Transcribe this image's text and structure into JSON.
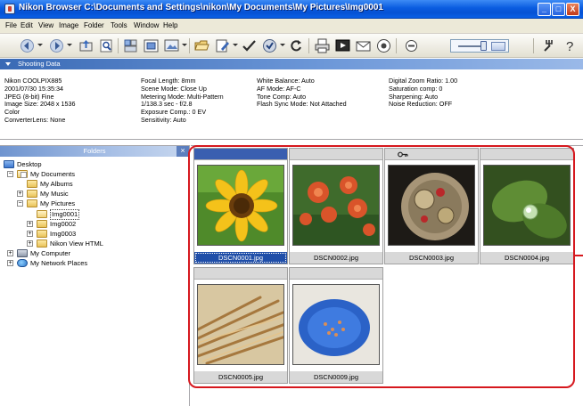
{
  "window": {
    "title": "Nikon Browser C:\\Documents and Settings\\nikon\\My Documents\\My Pictures\\Img0001",
    "buttons": {
      "minimize": "_",
      "maximize": "□",
      "close": "X"
    }
  },
  "menubar": [
    {
      "id": "file",
      "label": "File"
    },
    {
      "id": "edit",
      "label": "Edit"
    },
    {
      "id": "view",
      "label": "View"
    },
    {
      "id": "image",
      "label": "Image"
    },
    {
      "id": "folder",
      "label": "Folder"
    },
    {
      "id": "tools",
      "label": "Tools"
    },
    {
      "id": "window",
      "label": "Window"
    },
    {
      "id": "help",
      "label": "Help"
    }
  ],
  "toolbar": {
    "icons": [
      "back-icon",
      "forward-icon",
      "up-folder-icon",
      "search-icon",
      "browse-icon",
      "view-mode-icon",
      "slideshow-icon",
      "open-folder-icon",
      "edit-icon",
      "check-icon",
      "transfer-icon",
      "rotate-icon",
      "print-icon",
      "presentation-icon",
      "email-icon",
      "info-icon",
      "thumbnail-size-slider",
      "grid-icon",
      "settings-icon",
      "help-icon"
    ]
  },
  "shooting_data": {
    "header": "Shooting Data",
    "columns": [
      [
        "Nikon COOLPIX885",
        "2001/07/30 15:35:34",
        "JPEG (8-bit) Fine",
        "Image Size: 2048 x 1536",
        "Color",
        "ConverterLens: None"
      ],
      [
        "Focal Length: 8mm",
        "Scene Mode: Close Up",
        "Metering Mode: Multi-Pattern",
        "1/138.3 sec - f/2.8",
        "Exposure Comp.: 0 EV",
        "Sensitivity: Auto"
      ],
      [
        "White Balance: Auto",
        "AF Mode: AF-C",
        "Tone Comp: Auto",
        "Flash Sync Mode: Not Attached"
      ],
      [
        "Digital Zoom Ratio: 1.00",
        "Saturation comp: 0",
        "Sharpening: Auto",
        "Noise Reduction: OFF"
      ]
    ]
  },
  "folders": {
    "header": "Folders",
    "close": "×",
    "tree": [
      {
        "label": "Desktop",
        "icon": "desktop-icon",
        "toggle": ""
      },
      {
        "label": "My Documents",
        "icon": "documents-icon",
        "toggle": "−"
      },
      {
        "label": "My Albums",
        "icon": "folder-icon",
        "toggle": ""
      },
      {
        "label": "My Music",
        "icon": "folder-icon",
        "toggle": "+"
      },
      {
        "label": "My Pictures",
        "icon": "folder-icon",
        "toggle": "−"
      },
      {
        "label": "Img0001",
        "icon": "folder-open-icon",
        "toggle": "",
        "selected": true
      },
      {
        "label": "Img0002",
        "icon": "folder-icon",
        "toggle": "+"
      },
      {
        "label": "Img0003",
        "icon": "folder-icon",
        "toggle": "+"
      },
      {
        "label": "Nikon View HTML",
        "icon": "folder-icon",
        "toggle": "+"
      },
      {
        "label": "My Computer",
        "icon": "computer-icon",
        "toggle": "+"
      },
      {
        "label": "My Network Places",
        "icon": "network-icon",
        "toggle": "+"
      }
    ]
  },
  "thumbnails": [
    {
      "filename": "DSCN0001.jpg",
      "selected": true,
      "protected": false,
      "subject": "sunflower"
    },
    {
      "filename": "DSCN0002.jpg",
      "selected": false,
      "protected": false,
      "subject": "lilies"
    },
    {
      "filename": "DSCN0003.jpg",
      "selected": false,
      "protected": true,
      "subject": "watch-movement"
    },
    {
      "filename": "DSCN0004.jpg",
      "selected": false,
      "protected": false,
      "subject": "water-drop-leaf"
    },
    {
      "filename": "DSCN0005.jpg",
      "selected": false,
      "protected": false,
      "subject": "wheat"
    },
    {
      "filename": "DSCN0009.jpg",
      "selected": false,
      "protected": false,
      "subject": "blue-bowl"
    }
  ]
}
